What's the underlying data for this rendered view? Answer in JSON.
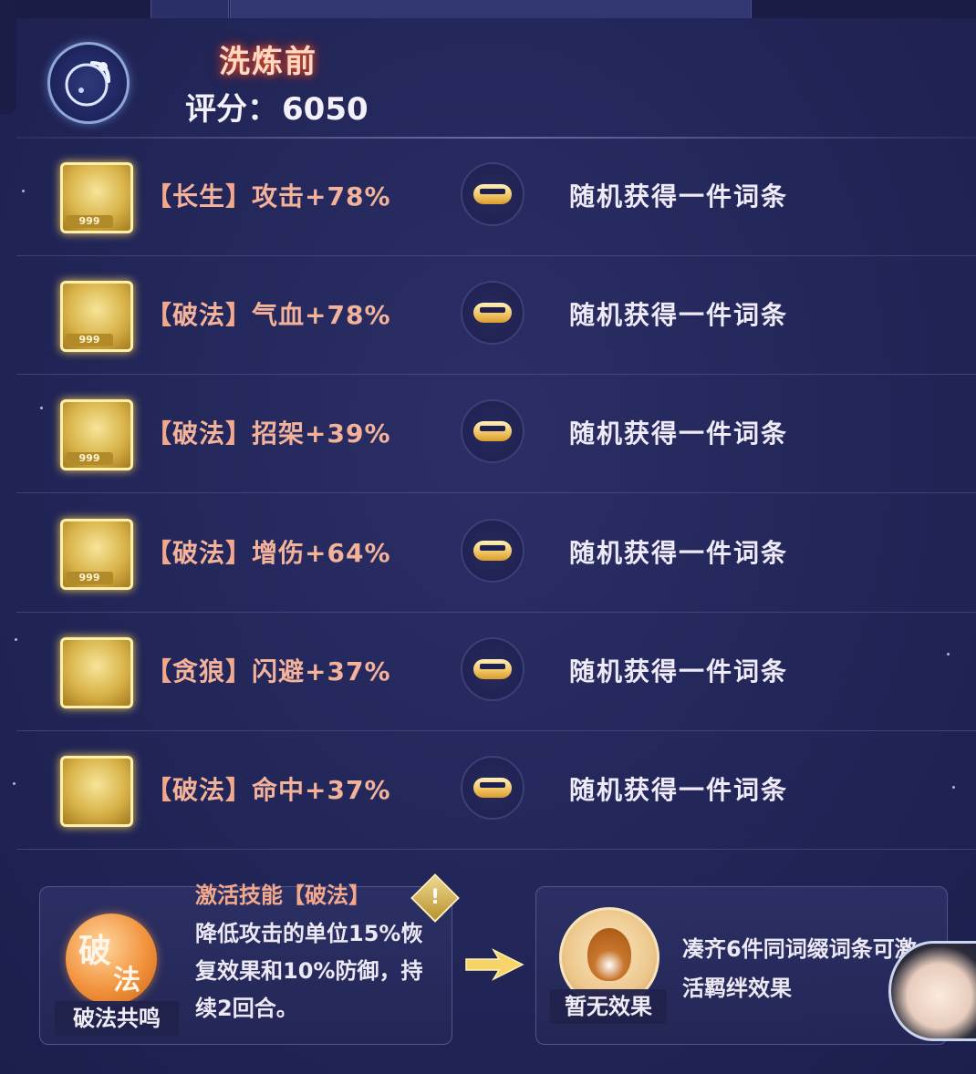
{
  "header": {
    "title": "洗炼前",
    "score_label": "评分：",
    "score_value": "6050"
  },
  "rows": [
    {
      "tag": "长生",
      "stat": "攻击+78%",
      "badge": "999",
      "result": "随机获得一件词条"
    },
    {
      "tag": "破法",
      "stat": "气血+78%",
      "badge": "999",
      "result": "随机获得一件词条"
    },
    {
      "tag": "破法",
      "stat": "招架+39%",
      "badge": "999",
      "result": "随机获得一件词条"
    },
    {
      "tag": "破法",
      "stat": "增伤+64%",
      "badge": "999",
      "result": "随机获得一件词条"
    },
    {
      "tag": "贪狼",
      "stat": "闪避+37%",
      "badge": "",
      "result": "随机获得一件词条"
    },
    {
      "tag": "破法",
      "stat": "命中+37%",
      "badge": "",
      "result": "随机获得一件词条"
    }
  ],
  "skill": {
    "orb_char1": "破",
    "orb_char2": "法",
    "name": "破法共鸣",
    "heading": "激活技能【破法】",
    "description": "降低攻击的单位15%恢复效果和10%防御，持续2回合。",
    "warn_icon": "!"
  },
  "bond": {
    "status": "暂无效果",
    "description": "凑齐6件同词缀词条可激活羁绊效果"
  },
  "colors": {
    "accent_salmon": "#f3b29a",
    "gold": "#f2c869",
    "background": "#23275a"
  },
  "icons": {
    "emblem": "moon-emblem-icon",
    "item": "gold-equipment-icon",
    "arrow": "transform-arrow-icon",
    "warning": "warning-icon",
    "bond": "flame-emblem-icon"
  }
}
